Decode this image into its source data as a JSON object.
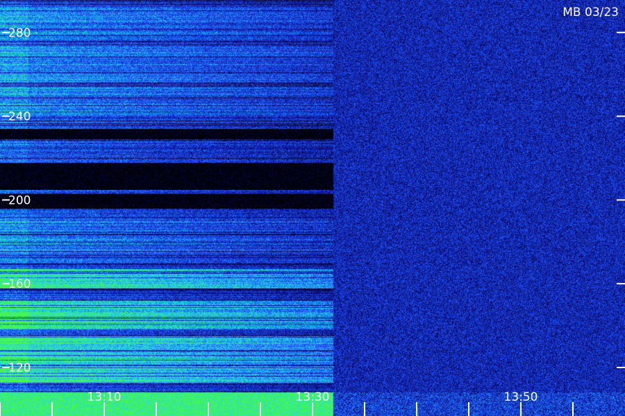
{
  "chart_data": {
    "type": "heatmap",
    "title": "MB 03/23",
    "colors": {
      "background": "#000000",
      "low": "#0a0a6e",
      "mid": "#1e50ff",
      "high": "#21d7e6",
      "peak": "#4fff2a",
      "text": "#ffffff"
    },
    "y_axis": {
      "ticks": [
        120,
        160,
        200,
        240,
        280
      ],
      "labels": [
        "120",
        "160",
        "200",
        "240",
        "280"
      ],
      "range": [
        110,
        296
      ]
    },
    "x_axis": {
      "labeled_ticks": [
        "13:10",
        "13:30",
        "13:50"
      ],
      "minor_ticks_per_major": 4,
      "range_minutes": [
        13.0,
        13.98
      ]
    },
    "signal_profile": {
      "active_until": "13:32",
      "after_active": "uniform low-level noise",
      "dark_gap_bands": [
        [
          205,
          218
        ],
        [
          196,
          203
        ],
        [
          229,
          234
        ]
      ],
      "strong_bands": [
        [
          113,
          135
        ],
        [
          138,
          152
        ],
        [
          158,
          168
        ]
      ],
      "moderate_bands": [
        [
          170,
          190
        ],
        [
          240,
          292
        ]
      ]
    }
  }
}
